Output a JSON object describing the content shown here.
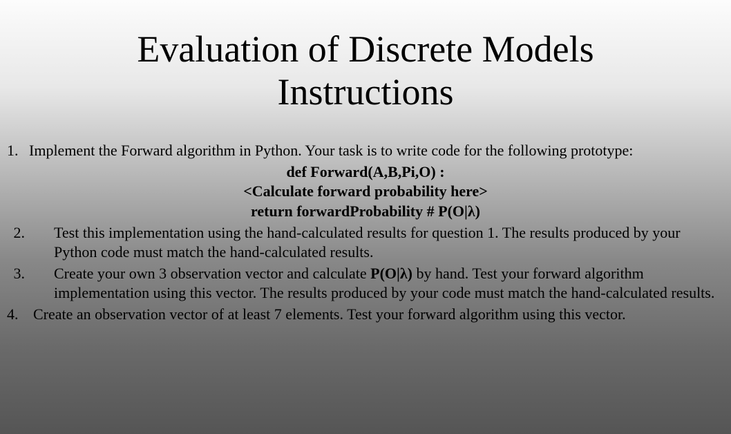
{
  "title_line1": "Evaluation of Discrete Models",
  "title_line2": "Instructions",
  "items": {
    "1": {
      "num": "1.",
      "text": "Implement the Forward algorithm in Python. Your task is to write code for the following prototype:"
    },
    "code": {
      "line1": "def Forward(A,B,Pi,O) :",
      "line2": "<Calculate forward probability here>",
      "line3": "return forwardProbability # P(O|λ)"
    },
    "2": {
      "num": "2.",
      "text": "Test this implementation using the hand-calculated results for question 1. The  results produced by your Python code must match the hand-calculated  results."
    },
    "3": {
      "num": "3.",
      "text_before": "Create your own 3 observation vector and calculate ",
      "bold": "P(O|λ)",
      "text_after": " by hand. Test your  forward algorithm implementation using this vector. The results produced by your code  must match the hand-calculated results."
    },
    "4": {
      "num": "4.",
      "text": "Create an observation vector of at least 7 elements. Test your forward  algorithm using this vector."
    }
  }
}
